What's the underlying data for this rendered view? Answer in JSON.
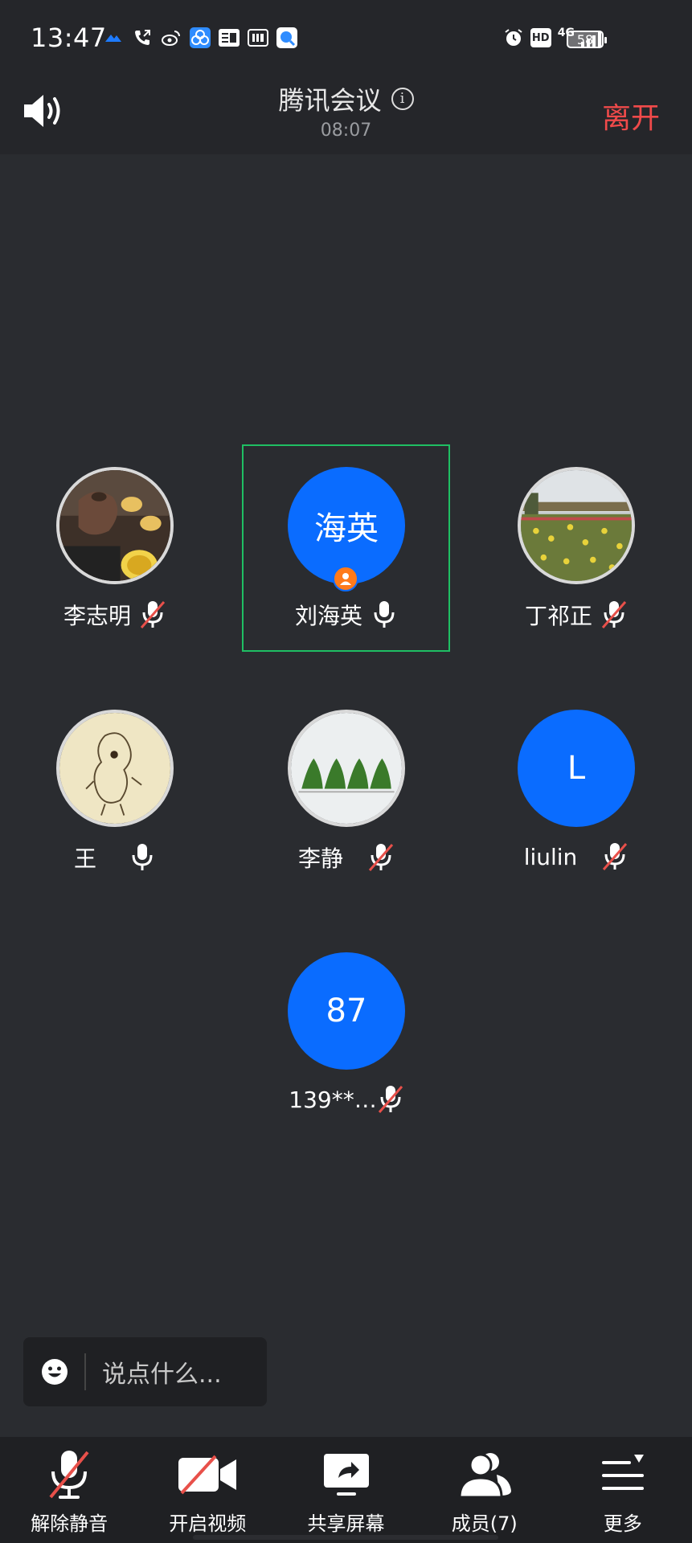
{
  "status_bar": {
    "time": "13:47",
    "network": "4G",
    "hd": "HD",
    "battery": "58",
    "icons": [
      "app-icon",
      "phone-icon",
      "weibo-icon",
      "app-icon",
      "toutiao-icon",
      "iqiyi-icon",
      "chat-app-icon",
      "alarm-icon",
      "signal-icon"
    ]
  },
  "header": {
    "title": "腾讯会议",
    "duration": "08:07",
    "leave_label": "离开",
    "info_glyph": "i"
  },
  "participants": [
    {
      "name": "李志明",
      "avatar_type": "photo",
      "avatar_text": "",
      "mic": "muted"
    },
    {
      "name": "刘海英",
      "avatar_type": "initials",
      "avatar_text": "海英",
      "mic": "on",
      "active": true,
      "host": true
    },
    {
      "name": "丁祁正",
      "avatar_type": "photo",
      "avatar_text": "",
      "mic": "muted"
    },
    {
      "name": "王",
      "avatar_type": "photo",
      "avatar_text": "",
      "mic": "on"
    },
    {
      "name": "李静",
      "avatar_type": "photo",
      "avatar_text": "",
      "mic": "muted"
    },
    {
      "name": "liulin",
      "avatar_type": "initials",
      "avatar_text": "L",
      "mic": "muted"
    },
    {
      "name": "139**…",
      "avatar_type": "initials",
      "avatar_text": "87",
      "mic": "muted"
    }
  ],
  "chat": {
    "placeholder": "说点什么..."
  },
  "toolbar": {
    "unmute_label": "解除静音",
    "video_label": "开启视频",
    "share_label": "共享屏幕",
    "members_label": "成员(7)",
    "more_label": "更多"
  },
  "colors": {
    "background": "#2a2c30",
    "bar": "#25262a",
    "accent_blue": "#0a6cff",
    "active_green": "#1fbf63",
    "leave_red": "#f04a4a",
    "host_orange": "#ff7a1a",
    "muted_red": "#e8504a"
  }
}
